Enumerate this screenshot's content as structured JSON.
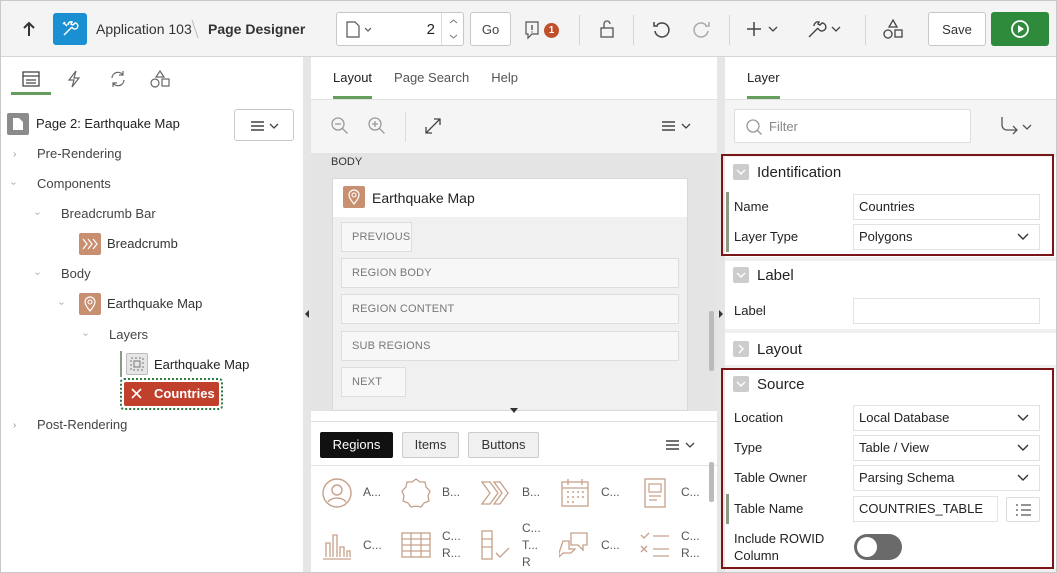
{
  "header": {
    "app_name": "Application 103",
    "page_designer": "Page Designer",
    "page_number": "2",
    "go_label": "Go",
    "issues_count": "1",
    "save_label": "Save",
    "accent": "#2e8b3c"
  },
  "left": {
    "tree": {
      "page_title": "Page 2: Earthquake Map",
      "pre_rendering": "Pre-Rendering",
      "components": "Components",
      "breadcrumb_bar": "Breadcrumb Bar",
      "breadcrumb": "Breadcrumb",
      "body": "Body",
      "earthquake_map": "Earthquake Map",
      "layers": "Layers",
      "layer_earthquake": "Earthquake Map",
      "layer_countries": "Countries",
      "post_rendering": "Post-Rendering"
    }
  },
  "middle": {
    "tabs": [
      "Layout",
      "Page Search",
      "Help"
    ],
    "body_label": "BODY",
    "region_title": "Earthquake Map",
    "zones": [
      "PREVIOUS",
      "REGION BODY",
      "REGION CONTENT",
      "SUB REGIONS",
      "NEXT"
    ],
    "gallery_tabs": [
      "Regions",
      "Items",
      "Buttons"
    ],
    "gallery_row1": [
      "A...",
      "B...",
      "B...",
      "C...",
      "C..."
    ],
    "gallery_row2": [
      [
        "C..."
      ],
      [
        "C...",
        "R..."
      ],
      [
        "C...",
        "T...",
        "R"
      ],
      [
        "C..."
      ],
      [
        "C...",
        "R..."
      ]
    ]
  },
  "right": {
    "tab": "Layer",
    "filter_placeholder": "Filter",
    "identification": {
      "title": "Identification",
      "name_label": "Name",
      "name_value": "Countries",
      "type_label": "Layer Type",
      "type_value": "Polygons"
    },
    "label_section": {
      "title": "Label",
      "label_label": "Label",
      "label_value": ""
    },
    "layout_section": {
      "title": "Layout"
    },
    "source": {
      "title": "Source",
      "location_label": "Location",
      "location_value": "Local Database",
      "type_label": "Type",
      "type_value": "Table / View",
      "owner_label": "Table Owner",
      "owner_value": "Parsing Schema",
      "table_label": "Table Name",
      "table_value": "COUNTRIES_TABLE",
      "rowid_label1": "Include ROWID",
      "rowid_label2": "Column"
    }
  }
}
